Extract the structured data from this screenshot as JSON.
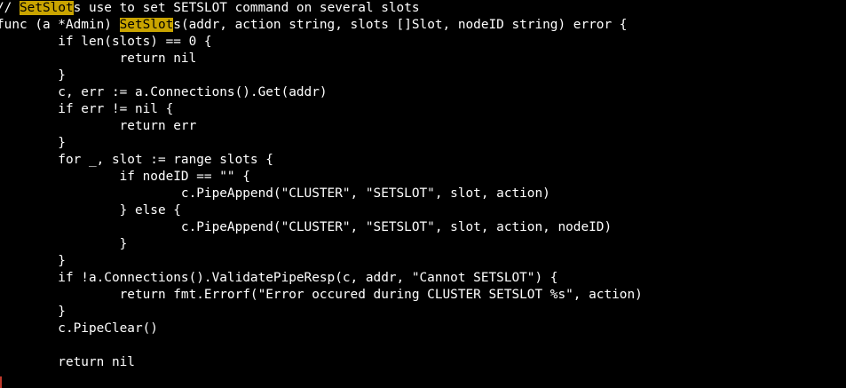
{
  "colors": {
    "background": "#000000",
    "text": "#ffffff",
    "search_highlight": "#c9a400"
  },
  "editor": {
    "lines": [
      {
        "segments": [
          {
            "text": "// "
          },
          {
            "text": "SetSlot",
            "hl": true
          },
          {
            "text": "s use to set SETSLOT command on several slots"
          }
        ]
      },
      {
        "segments": [
          {
            "text": "func (a *Admin) "
          },
          {
            "text": "SetSlot",
            "hl": true
          },
          {
            "text": "s(addr, action string, slots []Slot, nodeID string) error {"
          }
        ]
      },
      {
        "segments": [
          {
            "text": "        if len(slots) == 0 {"
          }
        ]
      },
      {
        "segments": [
          {
            "text": "                return nil"
          }
        ]
      },
      {
        "segments": [
          {
            "text": "        }"
          }
        ]
      },
      {
        "segments": [
          {
            "text": "        c, err := a.Connections().Get(addr)"
          }
        ]
      },
      {
        "segments": [
          {
            "text": "        if err != nil {"
          }
        ]
      },
      {
        "segments": [
          {
            "text": "                return err"
          }
        ]
      },
      {
        "segments": [
          {
            "text": "        }"
          }
        ]
      },
      {
        "segments": [
          {
            "text": "        for _, slot := range slots {"
          }
        ]
      },
      {
        "segments": [
          {
            "text": "                if nodeID == \"\" {"
          }
        ]
      },
      {
        "segments": [
          {
            "text": "                        c.PipeAppend(\"CLUSTER\", \"SETSLOT\", slot, action)"
          }
        ]
      },
      {
        "segments": [
          {
            "text": "                } else {"
          }
        ]
      },
      {
        "segments": [
          {
            "text": "                        c.PipeAppend(\"CLUSTER\", \"SETSLOT\", slot, action, nodeID)"
          }
        ]
      },
      {
        "segments": [
          {
            "text": "                }"
          }
        ]
      },
      {
        "segments": [
          {
            "text": "        }"
          }
        ]
      },
      {
        "segments": [
          {
            "text": "        if !a.Connections().ValidatePipeResp(c, addr, \"Cannot SETSLOT\") {"
          }
        ]
      },
      {
        "segments": [
          {
            "text": "                return fmt.Errorf(\"Error occured during CLUSTER SETSLOT %s\", action)"
          }
        ]
      },
      {
        "segments": [
          {
            "text": "        }"
          }
        ]
      },
      {
        "segments": [
          {
            "text": "        c.PipeClear()"
          }
        ]
      },
      {
        "segments": [
          {
            "text": ""
          }
        ]
      },
      {
        "segments": [
          {
            "text": "        return nil"
          }
        ]
      }
    ]
  }
}
